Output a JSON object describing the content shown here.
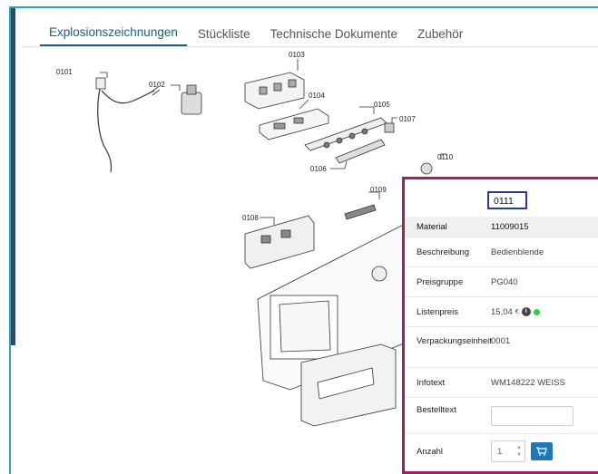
{
  "tabs": [
    {
      "label": "Explosionszeichnungen",
      "active": true
    },
    {
      "label": "Stückliste",
      "active": false
    },
    {
      "label": "Technische Dokumente",
      "active": false
    },
    {
      "label": "Zubehör",
      "active": false
    }
  ],
  "drawing": {
    "labels": [
      "0101",
      "0102",
      "0103",
      "0104",
      "0105",
      "0106",
      "0107",
      "0108",
      "0109",
      "0110",
      "0111"
    ]
  },
  "detail": {
    "selected_position": "0111",
    "header": {
      "label": "Material",
      "value": "11009015"
    },
    "rows": {
      "beschreibung": {
        "label": "Beschreibung",
        "value": "Bedienblende"
      },
      "preisgruppe": {
        "label": "Preisgruppe",
        "value": "PG040"
      },
      "listenpreis": {
        "label": "Listenpreis",
        "value": "15,04",
        "currency": "€"
      },
      "verpackung": {
        "label": "Verpackungseinheit",
        "value": "0001"
      },
      "infotext": {
        "label": "Infotext",
        "value": "WM148222 WEISS"
      },
      "bestelltext": {
        "label": "Bestelltext",
        "value": ""
      },
      "anzahl": {
        "label": "Anzahl",
        "value": "1"
      }
    },
    "availability_color": "#2ecc40",
    "icons": {
      "info": "info-circle-icon",
      "cart": "cart-icon",
      "status": "availability-dot-icon"
    }
  },
  "colors": {
    "accent": "#1a5f8a",
    "frame": "#2aa7b5",
    "highlight": "#a51f5f",
    "tag_border": "#2c3a9a",
    "cart": "#1d78b4"
  }
}
